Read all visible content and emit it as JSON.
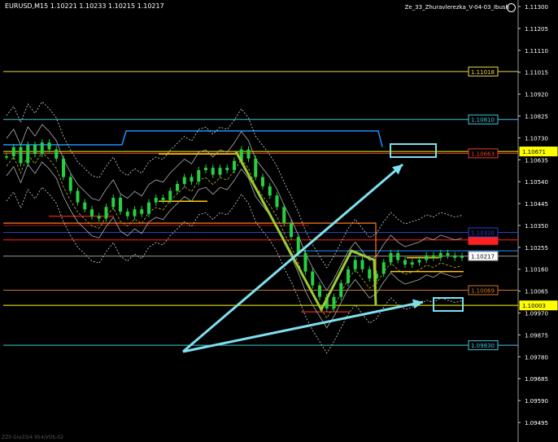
{
  "header": {
    "symbol_info": "EURUSD,M15  1.10221 1.10233 1.10215 1.10217",
    "indicator_title": "Ze_33_Zhuravlerezka_V-04-03_Ibush",
    "footer_text": "ZZ0 Gra33/4 954/VOS-02"
  },
  "chart_data": {
    "type": "line",
    "symbol": "EURUSD",
    "timeframe": "M15",
    "ohlc_last": {
      "open": 1.10221,
      "high": 1.10233,
      "low": 1.10215,
      "close": 1.10217
    },
    "ylim": [
      1.0944,
      1.113
    ],
    "y_ticks": [
      "1.11300",
      "1.11205",
      "1.11110",
      "1.11015",
      "1.10920",
      "1.10825",
      "1.10730",
      "1.10635",
      "1.10540",
      "1.10445",
      "1.10350",
      "1.10255",
      "1.10160",
      "1.10065",
      "1.09970",
      "1.09875",
      "1.09780",
      "1.09685",
      "1.09590",
      "1.09495"
    ],
    "levels": [
      {
        "label": "1.11018",
        "value": 1.11018,
        "color": "#e8d64a"
      },
      {
        "label": "1.10810",
        "value": 1.1081,
        "color": "#40c8d8"
      },
      {
        "label": "1.10671",
        "value": 1.10671,
        "color": "#ffff00"
      },
      {
        "label": "1.10663",
        "value": 1.10663,
        "color": "#e8402a"
      },
      {
        "label": "1.10287",
        "value": 1.10287,
        "color": "#ff2020"
      },
      {
        "label": "1.10217",
        "value": 1.10217,
        "color": "#9a9a9a"
      },
      {
        "label": "1.10069",
        "value": 1.10069,
        "color": "#d07828"
      },
      {
        "label": "1.10003",
        "value": 1.10003,
        "color": "#ffff00"
      },
      {
        "label": "1.09830",
        "value": 1.0983,
        "color": "#40c8d8"
      }
    ],
    "hidden_labels": [
      "1.10320",
      "1.10287"
    ],
    "price_series": [
      1.1065,
      1.1069,
      1.1062,
      1.107,
      1.1066,
      1.1071,
      1.1068,
      1.1064,
      1.1056,
      1.105,
      1.1045,
      1.1042,
      1.1039,
      1.1038,
      1.1043,
      1.1047,
      1.1041,
      1.1039,
      1.1042,
      1.104,
      1.1045,
      1.1047,
      1.1046,
      1.105,
      1.1053,
      1.1056,
      1.1054,
      1.1059,
      1.106,
      1.1057,
      1.106,
      1.1059,
      1.1063,
      1.1068,
      1.1064,
      1.1056,
      1.1052,
      1.1048,
      1.1043,
      1.1036,
      1.103,
      1.1023,
      1.1015,
      1.1009,
      1.1004,
      1.0999,
      1.1004,
      1.101,
      1.1016,
      1.102,
      1.1016,
      1.1012,
      1.1014,
      1.1019,
      1.1023,
      1.102,
      1.1018,
      1.1019,
      1.102,
      1.1022,
      1.1021,
      1.1023,
      1.1022,
      1.1021,
      1.10217
    ],
    "colors": {
      "background": "#000000",
      "candles": "#26d040",
      "zigzag": "#9acd32",
      "arrows": "#7fe0f0",
      "bands": "#b0b0b0",
      "envelope": "#c8b030",
      "channel": "#1f8fff",
      "box": "#ff7a1a"
    },
    "grid": false
  }
}
